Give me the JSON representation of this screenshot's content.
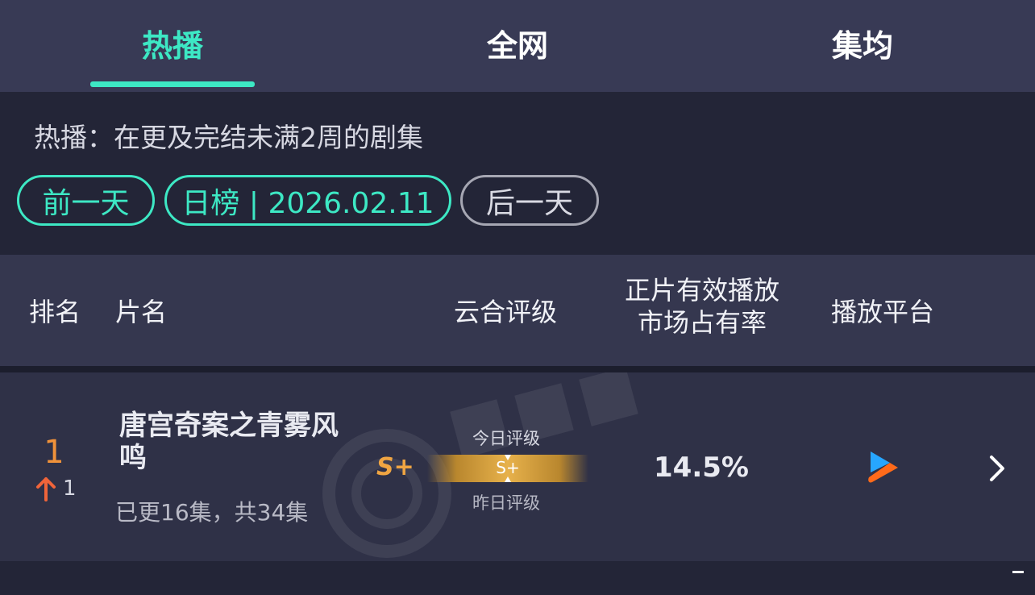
{
  "tabs": [
    {
      "label": "热播",
      "active": true
    },
    {
      "label": "全网",
      "active": false
    },
    {
      "label": "集均",
      "active": false
    }
  ],
  "filter": {
    "description": "热播：在更及完结未满2周的剧集",
    "prev_label": "前一天",
    "date_label": "日榜 | 2026.02.11",
    "next_label": "后一天"
  },
  "table": {
    "headers": {
      "rank": "排名",
      "title": "片名",
      "rating": "云合评级",
      "share_line1": "正片有效播放",
      "share_line2": "市场占有率",
      "platform": "播放平台"
    },
    "rows": [
      {
        "rank": "1",
        "rank_change": "1",
        "rank_change_direction": "up",
        "title": "唐宫奇案之青雾风鸣",
        "episodes": "已更16集，共34集",
        "grade": "S+",
        "today_label": "今日评级",
        "yesterday_label": "昨日评级",
        "yesterday_grade": "S+",
        "share": "14.5%",
        "platform_icon": "youku-icon"
      }
    ]
  },
  "colors": {
    "accent": "#3de8c4",
    "rank": "#f0923a",
    "grade": "#f0a542",
    "tab_bg": "#383a55",
    "header_bg": "#35374f",
    "row_bg": "#2f3147"
  }
}
